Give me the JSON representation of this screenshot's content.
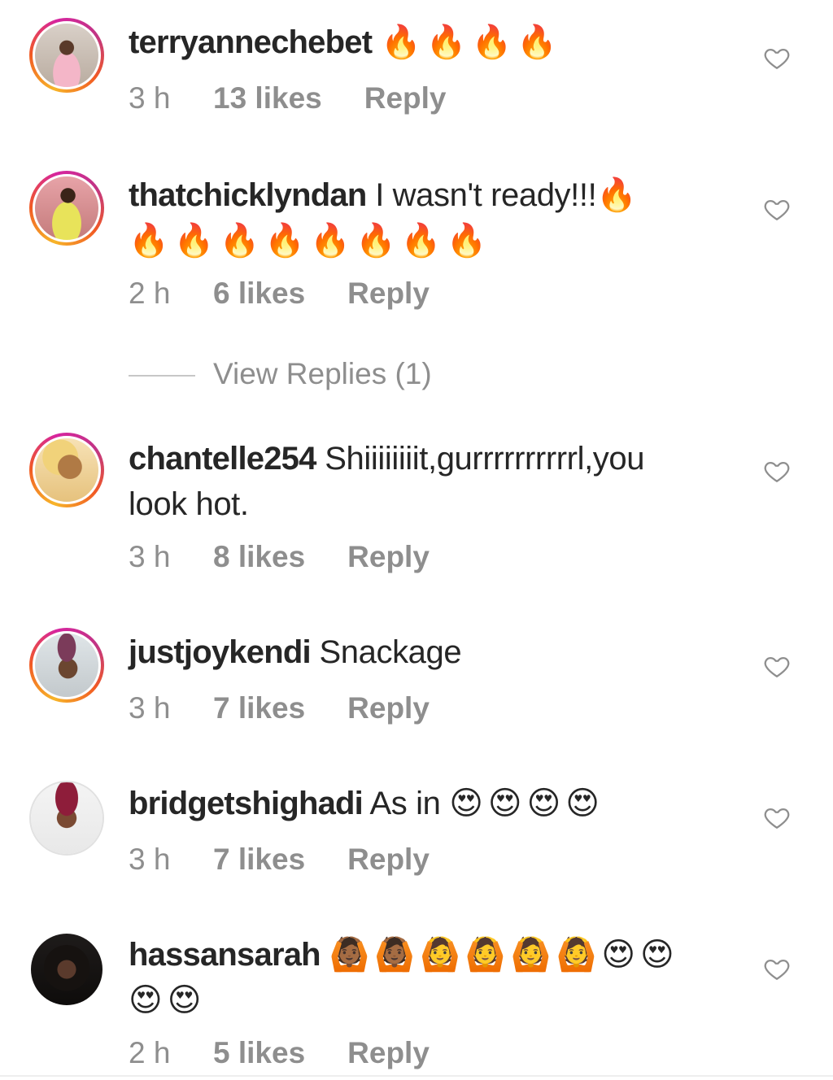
{
  "comments": [
    {
      "username": "terryannechebet",
      "text": "",
      "emojis": "🔥🔥🔥🔥",
      "emojis2": "",
      "time": "3 h",
      "likes": "13 likes",
      "reply": "Reply",
      "avatar_icon": "avatar-photo"
    },
    {
      "username": "thatchicklyndan",
      "text": "I wasn't ready!!!",
      "emojis": "🔥",
      "emojis2": "🔥🔥🔥🔥🔥🔥🔥🔥",
      "time": "2 h",
      "likes": "6 likes",
      "reply": "Reply",
      "avatar_icon": "avatar-photo"
    },
    {
      "username": "chantelle254",
      "text": "Shiiiiiiiit,gurrrrrrrrrrl,you",
      "text2": "look hot.",
      "time": "3 h",
      "likes": "8 likes",
      "reply": "Reply",
      "avatar_icon": "avatar-photo"
    },
    {
      "username": "justjoykendi",
      "text": "Snackage",
      "time": "3 h",
      "likes": "7 likes",
      "reply": "Reply",
      "avatar_icon": "avatar-photo"
    },
    {
      "username": "bridgetshighadi",
      "text": "As in",
      "emojis": "😍😍😍😍",
      "time": "3 h",
      "likes": "7 likes",
      "reply": "Reply",
      "avatar_icon": "avatar-photo"
    },
    {
      "username": "hassansarah",
      "text": "",
      "emojis": "🙆🏾🙆🏾🙆🙆🙆🙆😍😍",
      "emojis2": "😍😍",
      "time": "2 h",
      "likes": "5 likes",
      "reply": "Reply",
      "avatar_icon": "avatar-photo"
    }
  ],
  "view_replies": "View Replies (1)",
  "icons": {
    "like": "heart-outline-icon"
  },
  "colors": {
    "text": "#262626",
    "meta": "#8e8e8e",
    "story_ring_start": "#f7b529",
    "story_ring_end": "#d6249f"
  }
}
